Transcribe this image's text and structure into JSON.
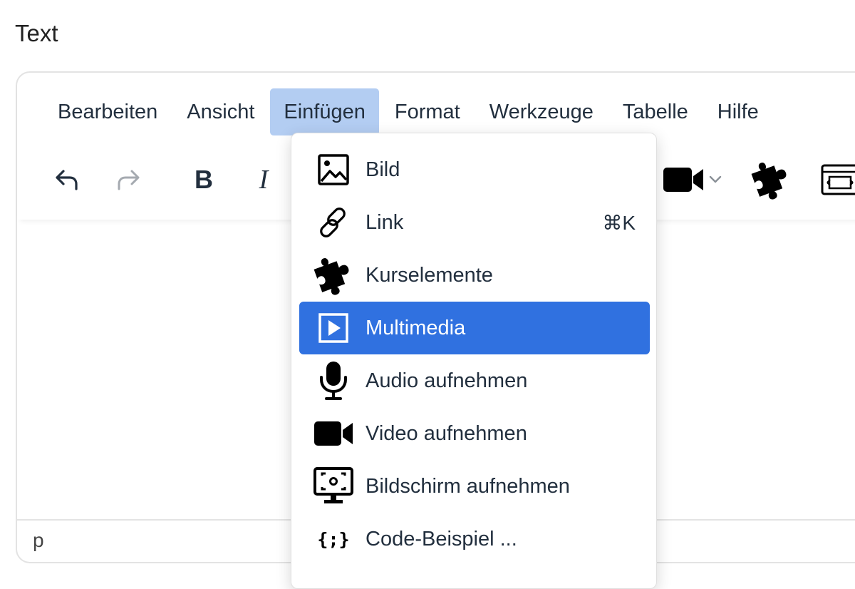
{
  "field_label": "Text",
  "menubar": {
    "items": [
      {
        "label": "Bearbeiten",
        "active": false
      },
      {
        "label": "Ansicht",
        "active": false
      },
      {
        "label": "Einfügen",
        "active": true
      },
      {
        "label": "Format",
        "active": false
      },
      {
        "label": "Werkzeuge",
        "active": false
      },
      {
        "label": "Tabelle",
        "active": false
      },
      {
        "label": "Hilfe",
        "active": false
      }
    ]
  },
  "toolbar": {
    "undo_icon": "undo-icon",
    "redo_icon": "redo-icon",
    "bold_label": "B",
    "italic_label": "I",
    "video_icon": "video-camera-icon",
    "plugin_icon": "puzzle-icon",
    "embed_icon": "embed-window-icon"
  },
  "insert_menu": {
    "items": [
      {
        "label": "Bild",
        "icon": "image-icon",
        "shortcut": ""
      },
      {
        "label": "Link",
        "icon": "link-icon",
        "shortcut": "⌘K"
      },
      {
        "label": "Kurselemente",
        "icon": "puzzle-icon",
        "shortcut": ""
      },
      {
        "label": "Multimedia",
        "icon": "multimedia-play-icon",
        "shortcut": "",
        "highlighted": true
      },
      {
        "label": "Audio aufnehmen",
        "icon": "microphone-icon",
        "shortcut": ""
      },
      {
        "label": "Video aufnehmen",
        "icon": "video-camera-icon",
        "shortcut": ""
      },
      {
        "label": "Bildschirm aufnehmen",
        "icon": "screen-record-icon",
        "shortcut": ""
      },
      {
        "label": "Code-Beispiel ...",
        "icon": "code-icon",
        "shortcut": ""
      }
    ]
  },
  "statusbar": {
    "path": "p"
  },
  "colors": {
    "menu_active_bg": "#b3cdf2",
    "item_highlight_bg": "#3071e0",
    "text": "#222f3e"
  }
}
